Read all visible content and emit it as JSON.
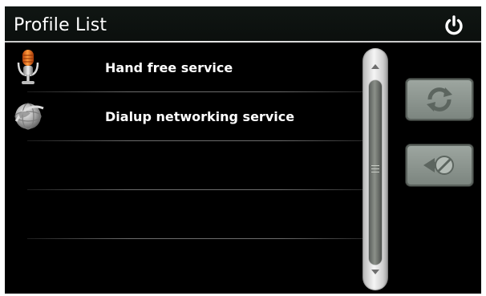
{
  "header": {
    "title": "Profile List",
    "power_icon": "power-icon"
  },
  "profile_list": {
    "items": [
      {
        "label": "Hand free service",
        "icon": "microphone-icon"
      },
      {
        "label": "Dialup networking service",
        "icon": "globe-icon"
      }
    ],
    "empty_rows": 3
  },
  "scrollbar": {
    "up_icon": "chevron-up-icon",
    "down_icon": "chevron-down-icon"
  },
  "side_buttons": [
    {
      "icon": "refresh-icon"
    },
    {
      "icon": "disconnect-icon"
    }
  ],
  "colors": {
    "background": "#000000",
    "text": "#ffffff",
    "button": "#8a938d"
  }
}
